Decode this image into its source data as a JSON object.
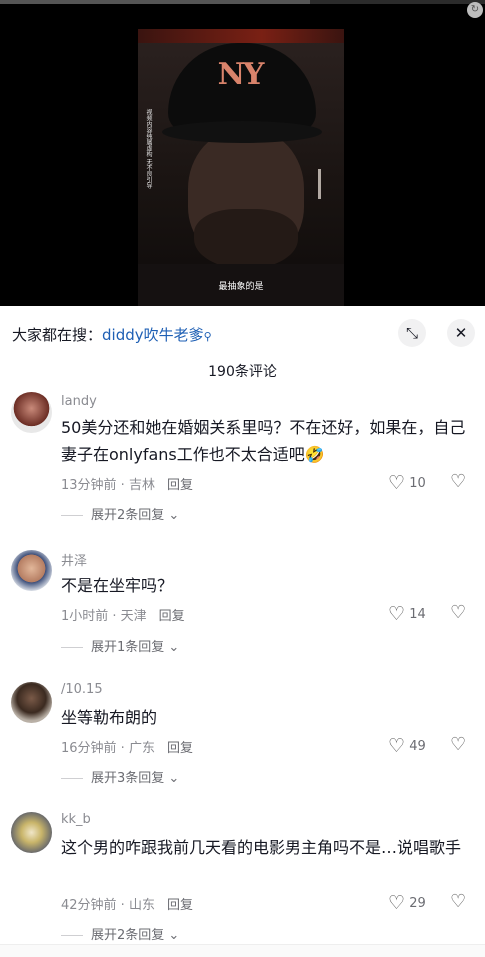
{
  "video": {
    "side_text": "视频内容纯属虚构 无不良引导",
    "subtitle": "最抽象的是",
    "cap_logo": "NY"
  },
  "search": {
    "prefix": "大家都在搜：",
    "keyword": "diddy吹牛老爹",
    "icon": "search-icon"
  },
  "comments_count": "190条评论",
  "comments": [
    {
      "username": "landy",
      "text": "50美分还和她在婚姻关系里吗？不在还好，如果在，自己妻子在onlyfans工作也不太合适吧🤣",
      "time_location": "13分钟前 · 吉林",
      "reply_label": "回复",
      "likes": "10",
      "expand_label": "展开2条回复"
    },
    {
      "username": "井泽",
      "text": "不是在坐牢吗？",
      "time_location": "1小时前 · 天津",
      "reply_label": "回复",
      "likes": "14",
      "expand_label": "展开1条回复"
    },
    {
      "username": "/10.15",
      "text": "坐等勒布朗的",
      "time_location": "16分钟前 · 广东",
      "reply_label": "回复",
      "likes": "49",
      "expand_label": "展开3条回复"
    },
    {
      "username": "kk_b",
      "text": "这个男的咋跟我前几天看的电影男主角吗不是…说唱歌手",
      "time_location": "42分钟前 · 山东",
      "reply_label": "回复",
      "likes": "29",
      "expand_label": "展开2条回复"
    }
  ]
}
